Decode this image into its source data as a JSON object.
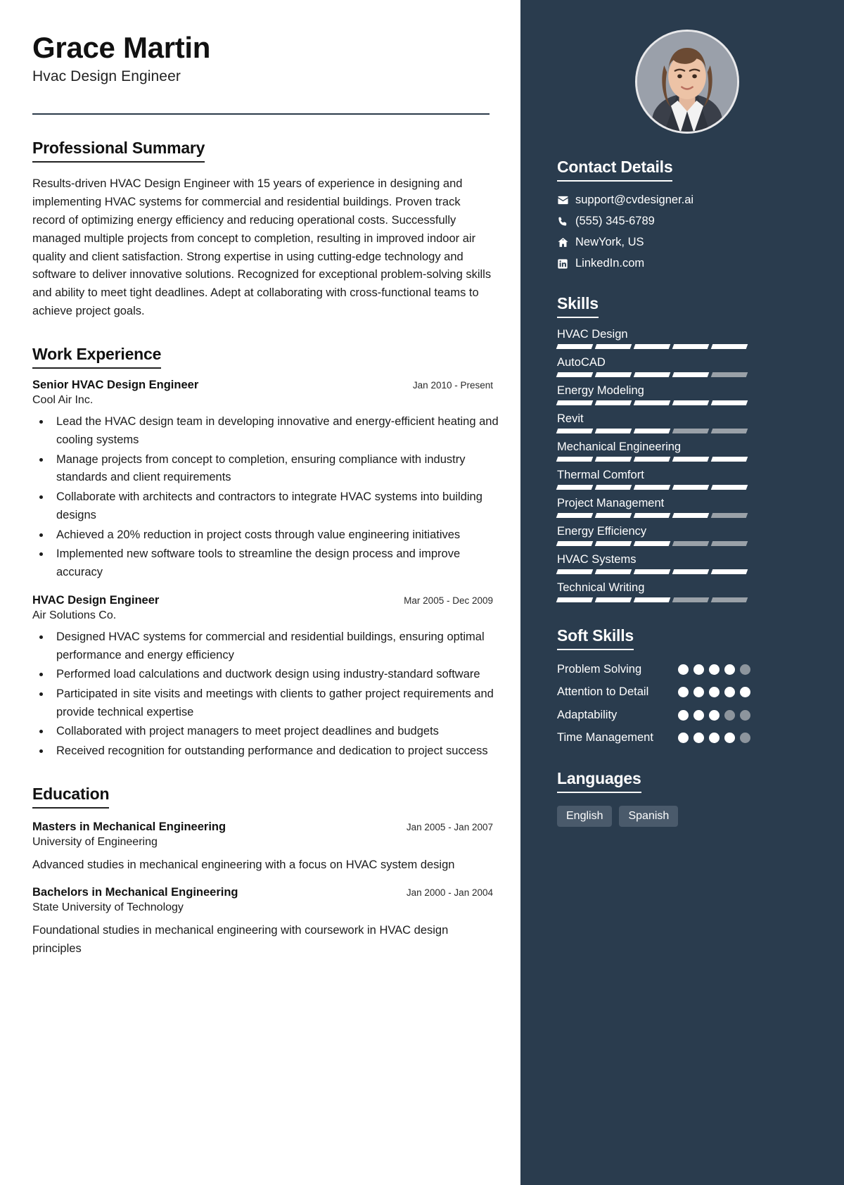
{
  "header": {
    "name": "Grace Martin",
    "job_title": "Hvac Design Engineer"
  },
  "sections": {
    "summary_title": "Professional Summary",
    "experience_title": "Work Experience",
    "education_title": "Education",
    "contact_title": "Contact Details",
    "skills_title": "Skills",
    "soft_skills_title": "Soft Skills",
    "languages_title": "Languages"
  },
  "summary": "Results-driven HVAC Design Engineer with 15 years of experience in designing and implementing HVAC systems for commercial and residential buildings. Proven track record of optimizing energy efficiency and reducing operational costs. Successfully managed multiple projects from concept to completion, resulting in improved indoor air quality and client satisfaction. Strong expertise in using cutting-edge technology and software to deliver innovative solutions. Recognized for exceptional problem-solving skills and ability to meet tight deadlines. Adept at collaborating with cross-functional teams to achieve project goals.",
  "experience": [
    {
      "title": "Senior HVAC Design Engineer",
      "date": "Jan 2010 - Present",
      "company": "Cool Air Inc.",
      "bullets": [
        "Lead the HVAC design team in developing innovative and energy-efficient heating and cooling systems",
        "Manage projects from concept to completion, ensuring compliance with industry standards and client requirements",
        "Collaborate with architects and contractors to integrate HVAC systems into building designs",
        "Achieved a 20% reduction in project costs through value engineering initiatives",
        "Implemented new software tools to streamline the design process and improve accuracy"
      ]
    },
    {
      "title": "HVAC Design Engineer",
      "date": "Mar 2005 - Dec 2009",
      "company": "Air Solutions Co.",
      "bullets": [
        "Designed HVAC systems for commercial and residential buildings, ensuring optimal performance and energy efficiency",
        "Performed load calculations and ductwork design using industry-standard software",
        "Participated in site visits and meetings with clients to gather project requirements and provide technical expertise",
        "Collaborated with project managers to meet project deadlines and budgets",
        "Received recognition for outstanding performance and dedication to project success"
      ]
    }
  ],
  "education": [
    {
      "degree": "Masters in Mechanical Engineering",
      "date": "Jan 2005 - Jan 2007",
      "school": "University of Engineering",
      "description": "Advanced studies in mechanical engineering with a focus on HVAC system design"
    },
    {
      "degree": "Bachelors in Mechanical Engineering",
      "date": "Jan 2000 - Jan 2004",
      "school": "State University of Technology",
      "description": "Foundational studies in mechanical engineering with coursework in HVAC design principles"
    }
  ],
  "contact": [
    {
      "icon": "email-icon",
      "value": "support@cvdesigner.ai"
    },
    {
      "icon": "phone-icon",
      "value": "(555) 345-6789"
    },
    {
      "icon": "home-icon",
      "value": "NewYork, US"
    },
    {
      "icon": "linkedin-icon",
      "value": "LinkedIn.com"
    }
  ],
  "skills": [
    {
      "name": "HVAC Design",
      "filled": 5,
      "total": 5
    },
    {
      "name": "AutoCAD",
      "filled": 4,
      "total": 5
    },
    {
      "name": "Energy Modeling",
      "filled": 5,
      "total": 5
    },
    {
      "name": "Revit",
      "filled": 3,
      "total": 5
    },
    {
      "name": "Mechanical Engineering",
      "filled": 5,
      "total": 5
    },
    {
      "name": "Thermal Comfort",
      "filled": 5,
      "total": 5
    },
    {
      "name": "Project Management",
      "filled": 4,
      "total": 5
    },
    {
      "name": "Energy Efficiency",
      "filled": 3,
      "total": 5
    },
    {
      "name": "HVAC Systems",
      "filled": 5,
      "total": 5
    },
    {
      "name": "Technical Writing",
      "filled": 3,
      "total": 5
    }
  ],
  "soft_skills": [
    {
      "name": "Problem Solving",
      "filled": 4,
      "total": 5
    },
    {
      "name": "Attention to Detail",
      "filled": 5,
      "total": 5
    },
    {
      "name": "Adaptability",
      "filled": 3,
      "total": 5
    },
    {
      "name": "Time Management",
      "filled": 4,
      "total": 5
    }
  ],
  "languages": [
    "English",
    "Spanish"
  ],
  "colors": {
    "sidebar_bg": "#2a3c4e",
    "accent": "#ffffff",
    "muted_bar": "#9aa1a8",
    "tag_bg": "#4a5a6b"
  }
}
